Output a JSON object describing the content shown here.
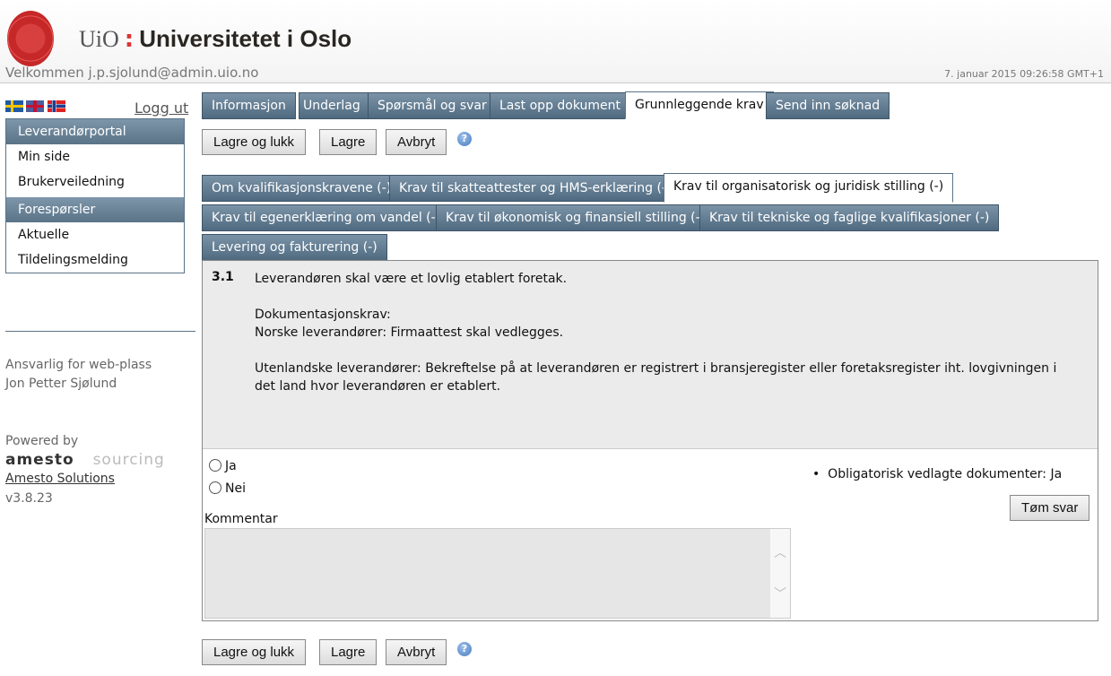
{
  "header": {
    "brand_short": "UiO",
    "brand_name": "Universitetet i Oslo",
    "welcome": "Velkommen j.p.sjolund@admin.uio.no",
    "date": "7. januar 2015 09:26:58 GMT+1",
    "logout": "Logg ut"
  },
  "flags": [
    "swedish-flag",
    "english-flag",
    "norwegian-flag"
  ],
  "sidebar": {
    "sections": [
      {
        "title": "Leverandørportal",
        "items": [
          "Min side",
          "Brukerveiledning"
        ]
      },
      {
        "title": "Forespørsler",
        "items": [
          "Aktuelle",
          "Tildelingsmelding"
        ]
      }
    ],
    "responsible_label": "Ansvarlig for web-plass",
    "responsible_name": "Jon Petter Sjølund",
    "powered_by": "Powered by",
    "logo_text": "amesto sourcing",
    "company_link": "Amesto Solutions",
    "version": "v3.8.23"
  },
  "main_tabs": [
    "Informasjon",
    "Underlag",
    "Spørsmål og svar",
    "Last opp dokument",
    "Grunnleggende krav",
    "Send inn søknad"
  ],
  "active_main_tab": "Grunnleggende krav",
  "buttons": {
    "save_close": "Lagre og lukk",
    "save": "Lagre",
    "cancel": "Avbryt",
    "clear": "Tøm svar",
    "help": "?"
  },
  "sub_tabs": [
    "Om kvalifikasjonskravene (-)",
    "Krav til skatteattester og HMS-erklæring (-)",
    "Krav til organisatorisk og juridisk stilling (-)",
    "Krav til egenerklæring om vandel (-)",
    "Krav til økonomisk og finansiell stilling (-)",
    "Krav til tekniske og faglige kvalifikasjoner (-)",
    "Levering og fakturering (-)"
  ],
  "active_sub_tab": "Krav til organisatorisk og juridisk stilling (-)",
  "question": {
    "number": "3.1",
    "lines": [
      "Leverandøren skal være et lovlig etablert foretak.",
      "",
      "Dokumentasjonskrav:",
      "Norske leverandører: Firmaattest skal vedlegges.",
      "",
      "Utenlandske leverandører: Bekreftelse på at leverandøren er registrert i bransjeregister eller foretaksregister iht. lovgivningen i det land hvor leverandøren er etablert."
    ],
    "options": [
      "Ja",
      "Nei"
    ],
    "selected": null,
    "comment_label": "Kommentar",
    "comment_value": "",
    "mandatory_docs": "Obligatorisk vedlagte dokumenter: Ja"
  }
}
